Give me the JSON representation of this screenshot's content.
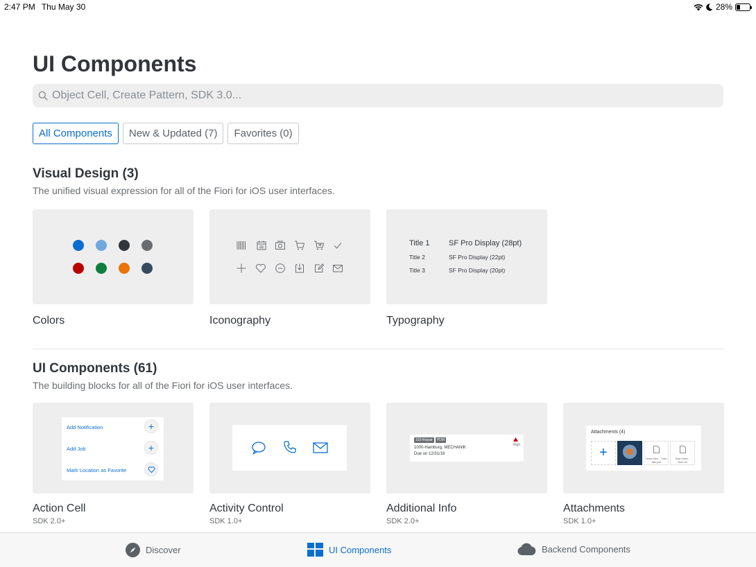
{
  "status_bar": {
    "time": "2:47 PM",
    "date": "Thu May 30",
    "battery": "28%",
    "battery_level": 0.28
  },
  "page": {
    "title": "UI Components"
  },
  "search": {
    "placeholder": "Object Cell, Create Pattern, SDK 3.0..."
  },
  "tabs": [
    {
      "label": "All Components",
      "active": true
    },
    {
      "label": "New & Updated (7)",
      "active": false
    },
    {
      "label": "Favorites (0)",
      "active": false
    }
  ],
  "sections": [
    {
      "title": "Visual Design (3)",
      "description": "The unified visual expression for all of the Fiori for iOS user interfaces.",
      "cards": [
        {
          "label": "Colors",
          "sdk": ""
        },
        {
          "label": "Iconography",
          "sdk": ""
        },
        {
          "label": "Typography",
          "sdk": ""
        }
      ]
    },
    {
      "title": "UI Components (61)",
      "description": "The building blocks for all of the Fiori for iOS user interfaces.",
      "cards": [
        {
          "label": "Action Cell",
          "sdk": "SDK 2.0+"
        },
        {
          "label": "Activity Control",
          "sdk": "SDK 1.0+"
        },
        {
          "label": "Additional Info",
          "sdk": "SDK 2.0+"
        },
        {
          "label": "Attachments",
          "sdk": "SDK 1.0+"
        }
      ]
    }
  ],
  "colors_swatches": [
    "#0a6ed1",
    "#6fa8dc",
    "#32363a",
    "#6a6d70",
    "#bb0000",
    "#107e3e",
    "#e9730c",
    "#354a5f"
  ],
  "iconography_icons": [
    "barcode-icon",
    "calendar-icon",
    "camera-icon",
    "cart-icon",
    "cart-full-icon",
    "checkmark-icon",
    "add-icon",
    "heart-icon",
    "minus-circle-icon",
    "download-icon",
    "edit-icon",
    "mail-icon"
  ],
  "typography": [
    {
      "style": "Title 1",
      "font": "SF Pro Display (28pt)"
    },
    {
      "style": "Title 2",
      "font": "SF Pro Display (22pt)"
    },
    {
      "style": "Title 3",
      "font": "SF Pro Display (20pt)"
    }
  ],
  "action_cell_preview": [
    "Add Notification",
    "Add Job",
    "Mark Location as Favorite"
  ],
  "activity_control_preview": [
    "message-icon",
    "phone-icon",
    "mail-icon"
  ],
  "additional_info_preview": {
    "tags": [
      "103-Repair",
      "PDM"
    ],
    "line1": "1000-Hamburg, MECHANIK",
    "line2": "Due on 12/31/16",
    "priority": "High"
  },
  "attachments_preview": {
    "title": "Attachments (4)",
    "files": [
      "Team Mee... Fate Alts.pdf",
      "Team Mee... Note.txt"
    ]
  },
  "bottom_nav": [
    {
      "label": "Discover",
      "icon": "compass-icon",
      "active": false
    },
    {
      "label": "UI Components",
      "icon": "grid-icon",
      "active": true
    },
    {
      "label": "Backend Components",
      "icon": "cloud-icon",
      "active": false
    }
  ],
  "colors": {
    "accent": "#0a6ed1",
    "text": "#32363a",
    "card_bg": "#eeeeef"
  }
}
